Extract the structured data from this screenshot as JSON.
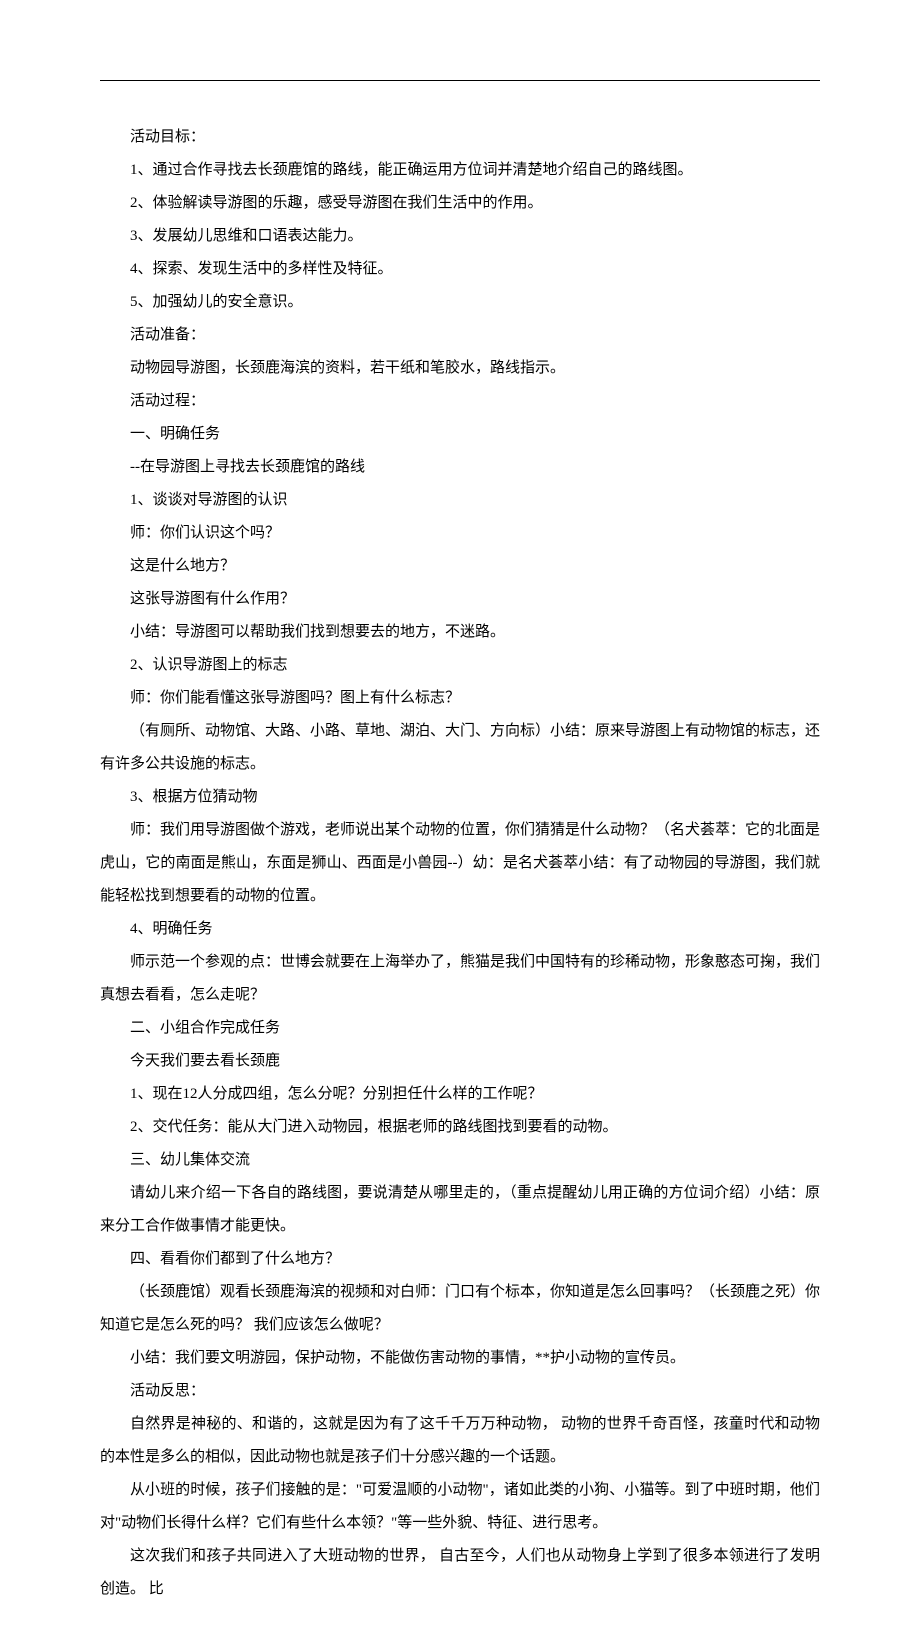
{
  "paragraphs": [
    "活动目标：",
    "1、通过合作寻找去长颈鹿馆的路线，能正确运用方位词并清楚地介绍自己的路线图。",
    "2、体验解读导游图的乐趣，感受导游图在我们生活中的作用。",
    "3、发展幼儿思维和口语表达能力。",
    "4、探索、发现生活中的多样性及特征。",
    "5、加强幼儿的安全意识。",
    "活动准备：",
    "动物园导游图，长颈鹿海滨的资料，若干纸和笔胶水，路线指示。",
    "活动过程：",
    "一、明确任务",
    "--在导游图上寻找去长颈鹿馆的路线",
    "1、谈谈对导游图的认识",
    "师：你们认识这个吗？",
    "这是什么地方？",
    "这张导游图有什么作用？",
    "小结：导游图可以帮助我们找到想要去的地方，不迷路。",
    "2、认识导游图上的标志",
    "师：你们能看懂这张导游图吗？图上有什么标志？",
    "（有厕所、动物馆、大路、小路、草地、湖泊、大门、方向标）小结：原来导游图上有动物馆的标志，还有许多公共设施的标志。",
    "3、根据方位猜动物",
    "师：我们用导游图做个游戏，老师说出某个动物的位置，你们猜猜是什么动物？（名犬荟萃：它的北面是虎山，它的南面是熊山，东面是狮山、西面是小兽园--）幼：是名犬荟萃小结：有了动物园的导游图，我们就能轻松找到想要看的动物的位置。",
    "4、明确任务",
    "师示范一个参观的点：世博会就要在上海举办了，熊猫是我们中国特有的珍稀动物，形象憨态可掬，我们真想去看看，怎么走呢？",
    "二、小组合作完成任务",
    "今天我们要去看长颈鹿",
    "1、现在12人分成四组，怎么分呢？分别担任什么样的工作呢？",
    "2、交代任务：能从大门进入动物园，根据老师的路线图找到要看的动物。",
    "三、幼儿集体交流",
    "请幼儿来介绍一下各自的路线图，要说清楚从哪里走的，（重点提醒幼儿用正确的方位词介绍）小结：原来分工合作做事情才能更快。",
    "四、看看你们都到了什么地方？",
    "（长颈鹿馆）观看长颈鹿海滨的视频和对白师：门口有个标本，你知道是怎么回事吗？（长颈鹿之死）你知道它是怎么死的吗？ 我们应该怎么做呢？",
    "小结：我们要文明游园，保护动物，不能做伤害动物的事情，**护小动物的宣传员。",
    "活动反思：",
    "自然界是神秘的、和谐的，这就是因为有了这千千万万种动物， 动物的世界千奇百怪，孩童时代和动物的本性是多么的相似，因此动物也就是孩子们十分感兴趣的一个话题。",
    "从小班的时候，孩子们接触的是：\"可爱温顺的小动物\"，诸如此类的小狗、小猫等。到了中班时期，他们对\"动物们长得什么样？它们有些什么本领？\"等一些外貌、特征、进行思考。",
    "这次我们和孩子共同进入了大班动物的世界， 自古至今，人们也从动物身上学到了很多本领进行了发明创造。 比"
  ]
}
